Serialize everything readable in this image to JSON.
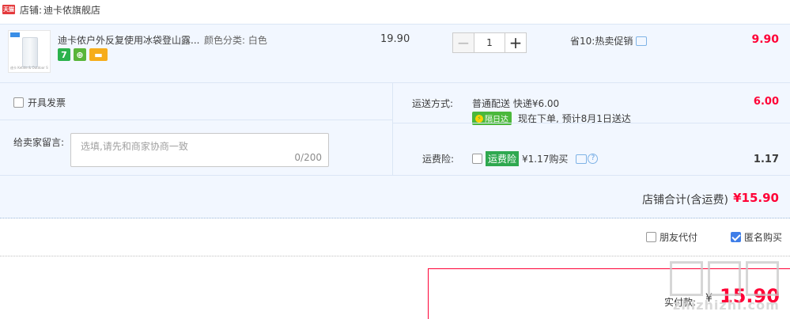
{
  "shop": {
    "badge": "天猫",
    "label": "店铺:",
    "name": "迪卡侬旗舰店"
  },
  "item": {
    "thumb_caption": "迪卡 Ketide & Outdoor Store",
    "title": "迪卡侬户外反复使用冰袋登山露...",
    "sku": "颜色分类: 白色",
    "service_icons": [
      "seven-day-return-icon",
      "guarantee-shield-icon",
      "credit-card-icon"
    ],
    "service_glyphs": [
      "7",
      "⊕",
      "▬"
    ],
    "unit_price": "19.90",
    "quantity": "1",
    "minus": "−",
    "plus": "+",
    "promo": "省10:热卖促销",
    "total": "9.90"
  },
  "options": {
    "invoice_label": "开具发票",
    "message_label": "给卖家留言:",
    "message_placeholder": "选填,请先和商家协商一致",
    "message_count": "0/200",
    "shipping_label": "运送方式:",
    "shipping_method": "普通配送 快递¥6.00",
    "sameday_badge": "隔日达",
    "delivery_note": "现在下单, 预计8月1日送达",
    "shipping_fee": "6.00",
    "insurance_label": "运费险:",
    "insurance_tag": "运费险",
    "insurance_price": "¥1.17购买",
    "insurance_fee": "1.17",
    "help_glyph": "?"
  },
  "subtotal": {
    "label": "店铺合计(含运费)",
    "value": "¥15.90"
  },
  "pay_options": {
    "friend_pay": "朋友代付",
    "anonymous": "匿名购买",
    "anonymous_checked": true
  },
  "final": {
    "label": "实付款:",
    "currency": "¥",
    "amount": "15.90"
  },
  "watermark": {
    "domain": "zhizhizhi.com"
  },
  "colors": {
    "price_red": "#ff0036",
    "row_bg": "#f2f7ff",
    "accent_blue": "#3f7ee8"
  }
}
